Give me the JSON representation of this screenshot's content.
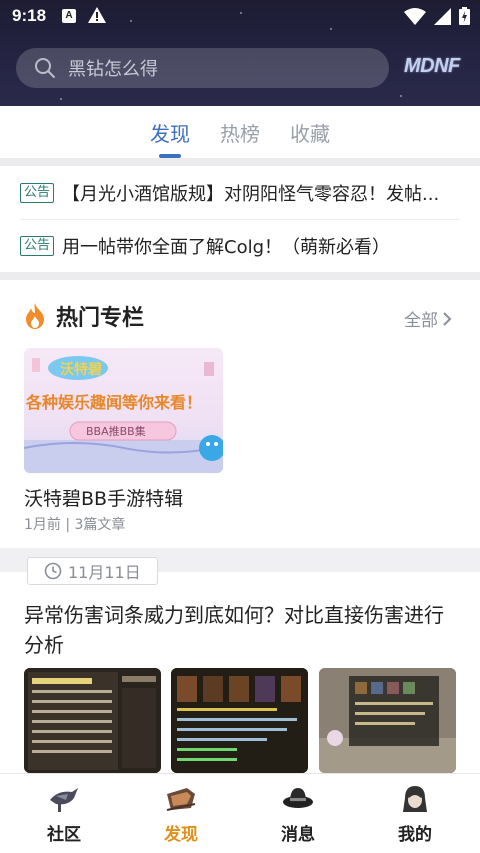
{
  "status_bar": {
    "time": "9:18",
    "a_icon": "A"
  },
  "search": {
    "placeholder": "黑钻怎么得"
  },
  "logo": {
    "text": "MDNF"
  },
  "tabs": [
    {
      "label": "发现",
      "active": true
    },
    {
      "label": "热榜",
      "active": false
    },
    {
      "label": "收藏",
      "active": false
    }
  ],
  "notices": [
    {
      "badge": "公告",
      "text": "【月光小酒馆版规】对阴阳怪气零容忍！发帖..."
    },
    {
      "badge": "公告",
      "text": "用一帖带你全面了解Colg！（萌新必看）"
    }
  ],
  "hot_columns": {
    "title": "热门专栏",
    "all_label": "全部",
    "card": {
      "image_title": "沃特碧",
      "image_banner": "各种娱乐趣闻等你来看！",
      "image_button": "BBA推BB集",
      "title": "沃特碧BB手游特辑",
      "meta": "1月前 | 3篇文章"
    }
  },
  "feed": {
    "date": "11月11日",
    "article_title": "异常伤害词条威力到底如何？对比直接伤害进行分析"
  },
  "bottom_nav": [
    {
      "label": "社区",
      "icon": "community-icon",
      "active": false
    },
    {
      "label": "发现",
      "icon": "discover-icon",
      "active": true
    },
    {
      "label": "消息",
      "icon": "message-icon",
      "active": false
    },
    {
      "label": "我的",
      "icon": "profile-icon",
      "active": false
    }
  ],
  "colors": {
    "accent": "#3d6fbf",
    "nav_active": "#e0901a",
    "notice": "#2a7a72",
    "header_bg": "#252443"
  }
}
